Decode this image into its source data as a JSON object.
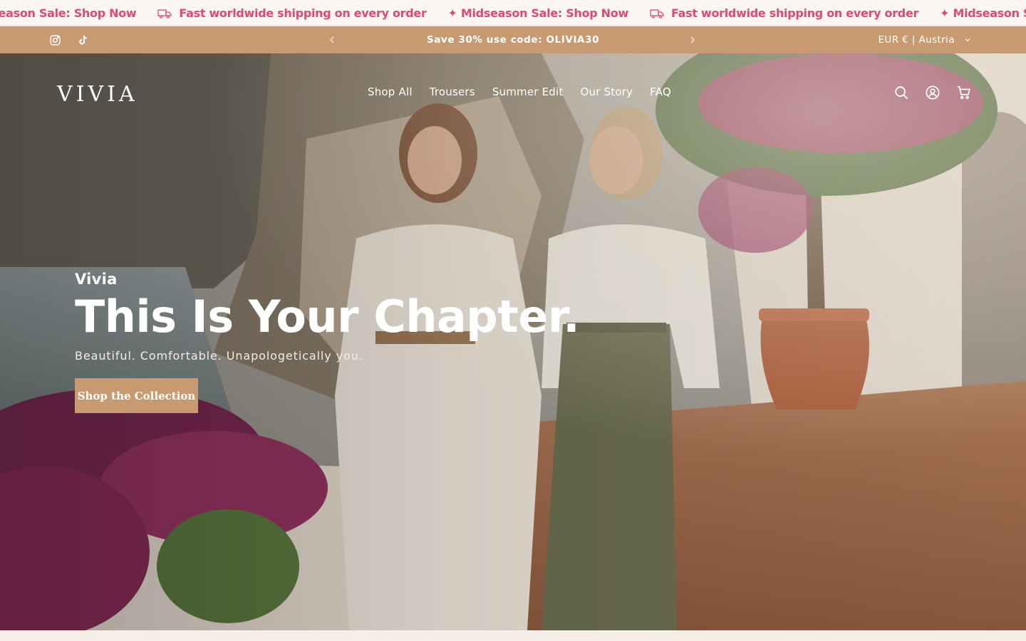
{
  "marquee": {
    "items": [
      {
        "text": "✦ Midseason Sale: Shop Now",
        "icon": "sparkle-icon"
      },
      {
        "text": "Fast worldwide shipping on every order",
        "icon": "truck-icon"
      },
      {
        "text": "✦ Midseason Sale: Shop Now",
        "icon": "sparkle-icon"
      },
      {
        "text": "Fast worldwide shipping on every order",
        "icon": "truck-icon"
      },
      {
        "text": "✦ Midseason Sale: Shop Now",
        "icon": "sparkle-icon"
      }
    ],
    "color": "#e0487a"
  },
  "announcement": {
    "text": "Save 30% use code: OLIVIA30",
    "prev_icon": "chevron-left-icon",
    "next_icon": "chevron-right-icon",
    "background": "#c89a72",
    "social": [
      "instagram-icon",
      "tiktok-icon"
    ],
    "currency": "EUR € | Austria"
  },
  "header": {
    "logo": "VIVIA",
    "nav": [
      "Shop All",
      "Trousers",
      "Summer Edit",
      "Our Story",
      "FAQ"
    ],
    "icons": [
      "search-icon",
      "account-icon",
      "cart-icon"
    ]
  },
  "hero": {
    "eyebrow": "Vivia",
    "headline": "This Is Your Chapter.",
    "subheading": "Beautiful. Comfortable. Unapologetically you.",
    "cta": "Shop the Collection",
    "cta_color": "#c89a72"
  }
}
